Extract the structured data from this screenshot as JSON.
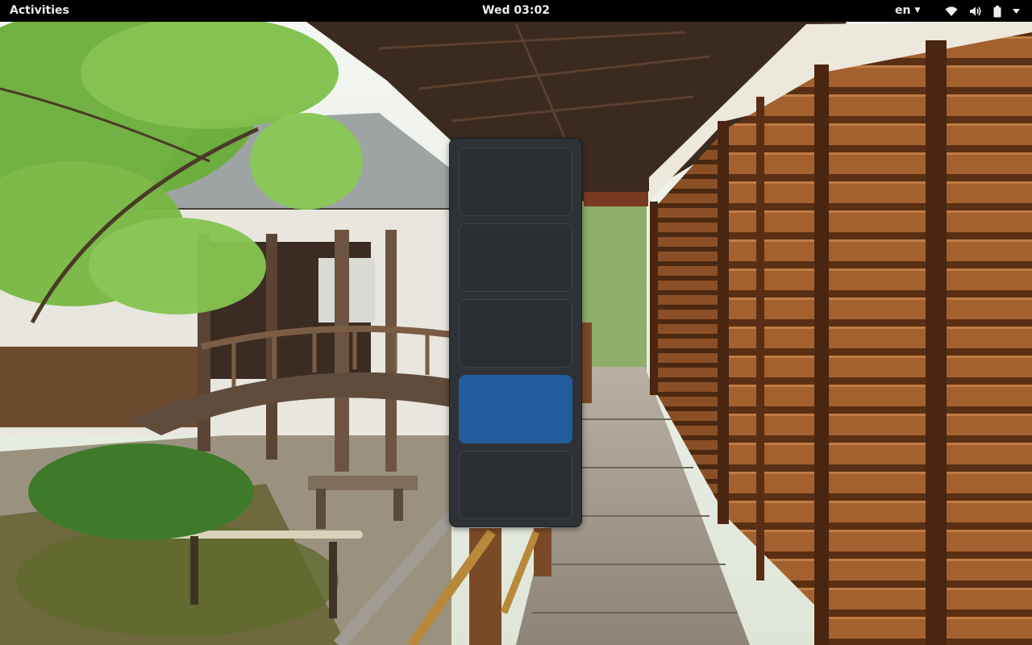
{
  "topbar": {
    "activities_label": "Activities",
    "clock_label": "Wed 03:02",
    "language_label": "en",
    "indicators": [
      "wifi-icon",
      "volume-icon",
      "battery-icon"
    ],
    "background_color": "#000000",
    "text_color": "#eeeeee"
  },
  "workspace_switcher": {
    "workspace_count": 5,
    "active_index": 3,
    "active_color": "#215d9c",
    "inactive_color": "#2b2f33"
  }
}
